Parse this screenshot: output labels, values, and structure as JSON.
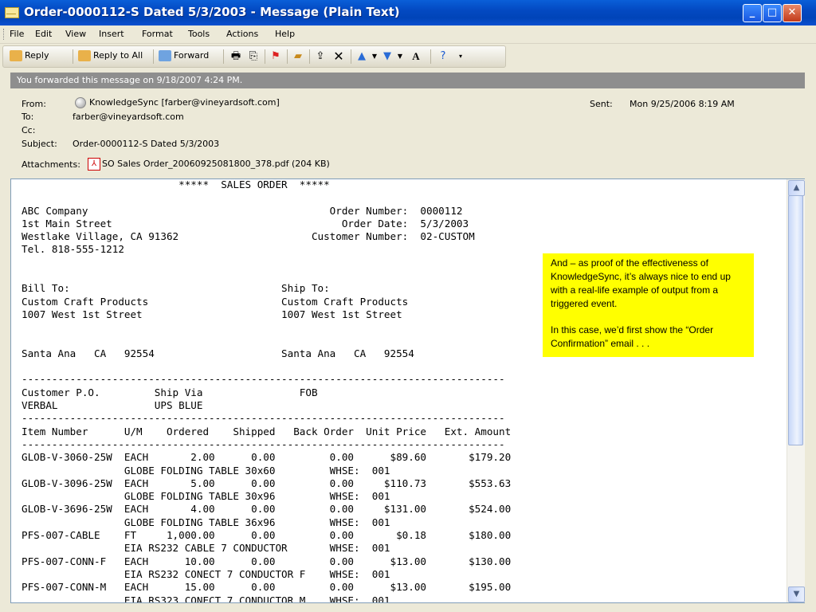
{
  "window": {
    "title": "Order-0000112-S Dated 5/3/2003  - Message (Plain Text)",
    "icon": "envelope-icon"
  },
  "menu": [
    "File",
    "Edit",
    "View",
    "Insert",
    "Format",
    "Tools",
    "Actions",
    "Help"
  ],
  "toolbar": {
    "reply": "Reply",
    "reply_all": "Reply to All",
    "forward": "Forward"
  },
  "infobar": "You forwarded this message on 9/18/2007 4:24 PM.",
  "header": {
    "from_label": "From:",
    "from_value": "KnowledgeSync [farber@vineyardsoft.com]",
    "to_label": "To:",
    "to_value": "farber@vineyardsoft.com",
    "cc_label": "Cc:",
    "subject_label": "Subject:",
    "subject_value": "Order-0000112-S Dated 5/3/2003",
    "attachments_label": "Attachments:",
    "attachment_name": "SO Sales Order_20060925081800_378.pdf (204 KB)",
    "sent_label": "Sent:",
    "sent_value": "Mon 9/25/2006 8:19 AM"
  },
  "message_body": "                          *****  SALES ORDER  *****\n\nABC Company                                        Order Number:  0000112\n1st Main Street                                      Order Date:  5/3/2003\nWestlake Village, CA 91362                      Customer Number:  02-CUSTOM\nTel. 818-555-1212\n\n\nBill To:                                   Ship To:\nCustom Craft Products                      Custom Craft Products\n1007 West 1st Street                       1007 West 1st Street\n\n\nSanta Ana   CA   92554                     Santa Ana   CA   92554\n\n--------------------------------------------------------------------------------\nCustomer P.O.         Ship Via                FOB\nVERBAL                UPS BLUE\n--------------------------------------------------------------------------------\nItem Number      U/M    Ordered    Shipped   Back Order  Unit Price   Ext. Amount\n--------------------------------------------------------------------------------\nGLOB-V-3060-25W  EACH       2.00      0.00         0.00      $89.60       $179.20\n                 GLOBE FOLDING TABLE 30x60         WHSE:  001\nGLOB-V-3096-25W  EACH       5.00      0.00         0.00     $110.73       $553.63\n                 GLOBE FOLDING TABLE 30x96         WHSE:  001\nGLOB-V-3696-25W  EACH       4.00      0.00         0.00     $131.00       $524.00\n                 GLOBE FOLDING TABLE 36x96         WHSE:  001\nPFS-007-CABLE    FT     1,000.00      0.00         0.00       $0.18       $180.00\n                 EIA RS232 CABLE 7 CONDUCTOR       WHSE:  001\nPFS-007-CONN-F   EACH      10.00      0.00         0.00      $13.00       $130.00\n                 EIA RS232 CONECT 7 CONDUCTOR F    WHSE:  001\nPFS-007-CONN-M   EACH      15.00      0.00         0.00      $13.00       $195.00\n                 EIA RS323 CONECT 7 CONDUCTOR M    WHSE:  001",
  "callout": {
    "paragraph1": "And – as proof of the effectiveness of KnowledgeSync, it’s always nice to end up with a real-life example of output from a triggered event.",
    "paragraph2": "In this case, we’d first show the “Order Confirmation” email . . ."
  },
  "colors": {
    "titlebar": "#0349c2",
    "callout": "#ffff00",
    "infobar": "#8e8e8e"
  }
}
